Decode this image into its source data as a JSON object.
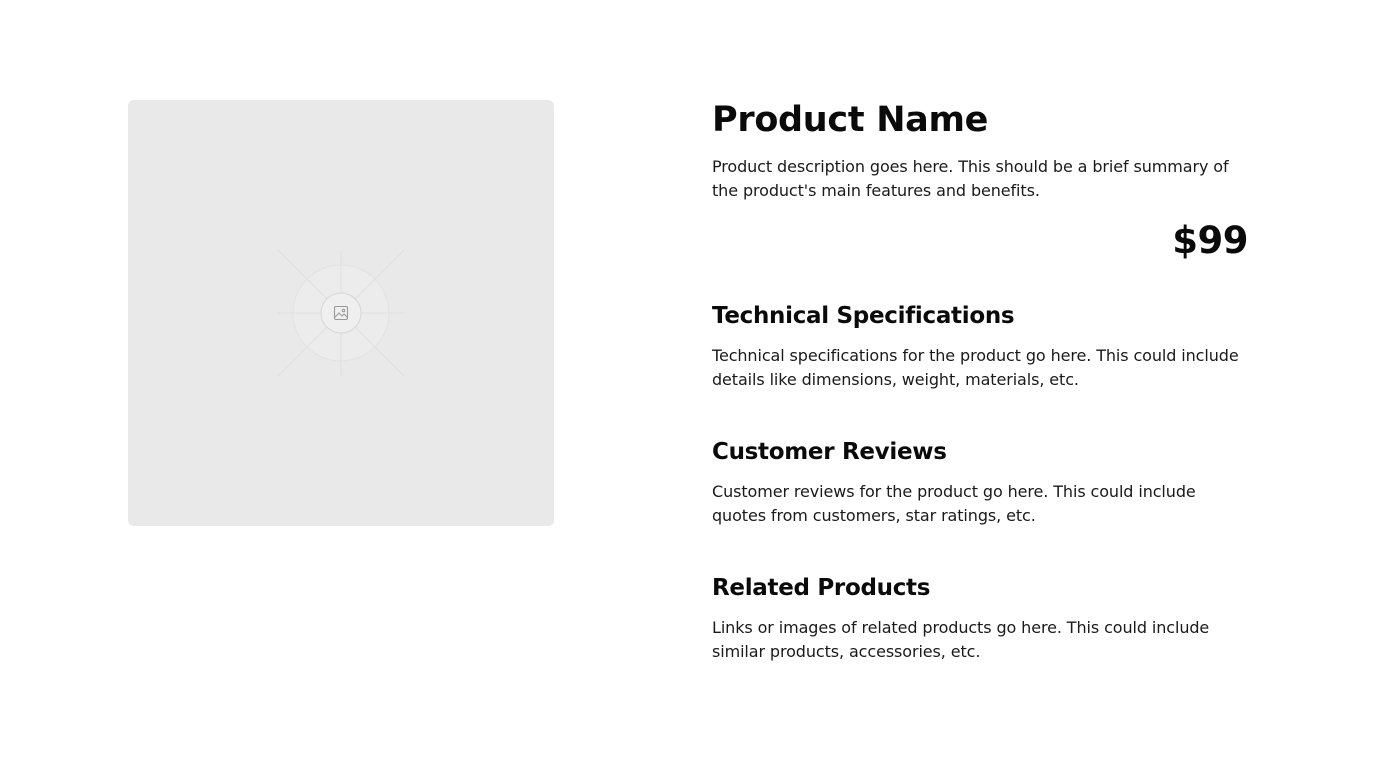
{
  "product": {
    "name": "Product Name",
    "description": "Product description goes here. This should be a brief summary of the product's main features and benefits.",
    "price": "$99",
    "image_icon": "image-icon"
  },
  "sections": [
    {
      "title": "Technical Specifications",
      "body": "Technical specifications for the product go here. This could include details like dimensions, weight, materials, etc."
    },
    {
      "title": "Customer Reviews",
      "body": "Customer reviews for the product go here. This could include quotes from customers, star ratings, etc."
    },
    {
      "title": "Related Products",
      "body": "Links or images of related products go here. This could include similar products, accessories, etc."
    }
  ],
  "colors": {
    "placeholder_bg": "#e9e9e9",
    "text": "#111111"
  }
}
